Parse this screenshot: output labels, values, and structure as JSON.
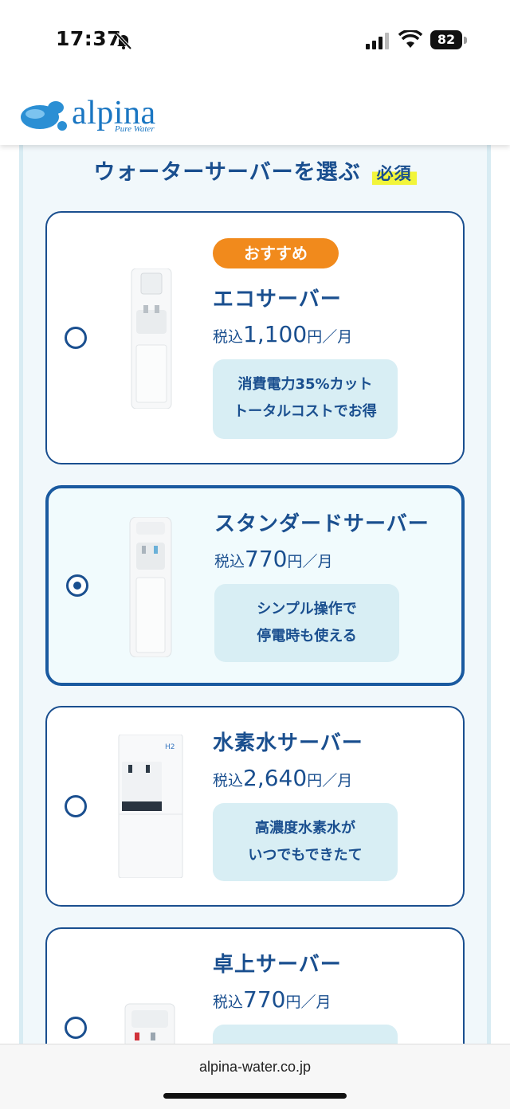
{
  "status_bar": {
    "time": "17:37",
    "battery": "82"
  },
  "header": {
    "logo_text": "alpina",
    "logo_sub": "Pure Water",
    "brand_color": "#1a76c2"
  },
  "section": {
    "title": "ウォーターサーバーを選ぶ",
    "required_label": "必須"
  },
  "servers": [
    {
      "badge": "おすすめ",
      "name": "エコサーバー",
      "price_prefix": "税込",
      "price": "1,100",
      "price_suffix": "円／月",
      "features": [
        "消費電力35%カット",
        "トータルコストでお得"
      ],
      "selected": false
    },
    {
      "name": "スタンダードサーバー",
      "price_prefix": "税込",
      "price": "770",
      "price_suffix": "円／月",
      "features": [
        "シンプル操作で",
        "停電時も使える"
      ],
      "selected": true
    },
    {
      "name": "水素水サーバー",
      "price_prefix": "税込",
      "price": "2,640",
      "price_suffix": "円／月",
      "features": [
        "高濃度水素水が",
        "いつでもできたて"
      ],
      "selected": false
    },
    {
      "name": "卓上サーバー",
      "price_prefix": "税込",
      "price": "770",
      "price_suffix": "円／月",
      "features": [],
      "selected": false
    }
  ],
  "browser": {
    "url": "alpina-water.co.jp"
  },
  "colors": {
    "primary": "#1a4f8f",
    "badge": "#f18a1c",
    "feature_bg": "#d8eef4",
    "highlight": "#f2f53a"
  }
}
